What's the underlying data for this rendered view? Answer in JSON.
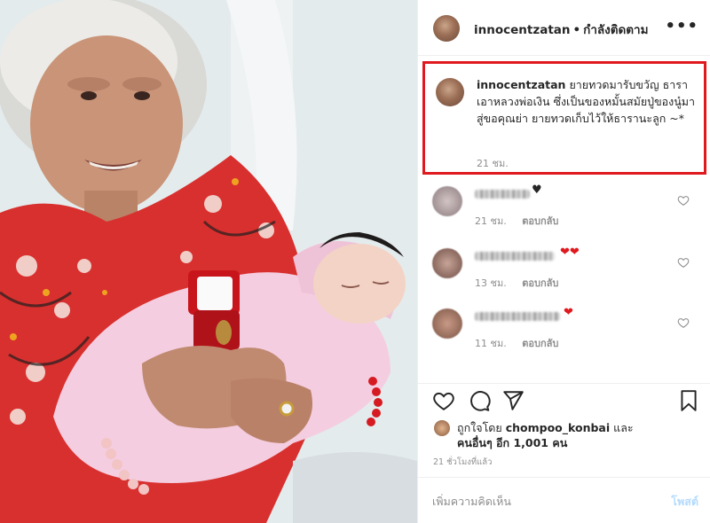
{
  "header": {
    "username": "innocentzatan",
    "separator": "•",
    "follow_status": "กำลังติดตาม",
    "more_glyph": "•••"
  },
  "caption": {
    "username": "innocentzatan",
    "text": "ยายทวดมารับขวัญ ธารา เอาหลวงพ่อเงิน ซึ่งเป็นของหมั้นสมัยปู่ของนู๋มาสู่ขอคุณย่า ยายทวดเก็บไว้ให้ธารานะลูก ~*",
    "time": "21 ชม.",
    "highlight_color": "#e0191f"
  },
  "comments": [
    {
      "time": "21 ชม.",
      "reply_label": "ตอบกลับ",
      "emoji": "♥",
      "emoji_color": "#262626"
    },
    {
      "time": "13 ชม.",
      "reply_label": "ตอบกลับ",
      "emoji": "❤❤",
      "emoji_color": "#e0191f"
    },
    {
      "time": "11 ชม.",
      "reply_label": "ตอบกลับ",
      "emoji": "❤",
      "emoji_color": "#e0191f"
    }
  ],
  "actions": {
    "like_icon": "heart-icon",
    "comment_icon": "comment-icon",
    "share_icon": "send-icon",
    "save_icon": "bookmark-icon"
  },
  "likes": {
    "prefix": "ถูกใจโดย",
    "liker": "chompoo_konbai",
    "conjunction": "และ",
    "others": "คนอื่นๆ อีก 1,001 คน"
  },
  "post_time": "21 ชั่วโมงที่แล้ว",
  "add_comment": {
    "placeholder": "เพิ่มความคิดเห็น",
    "post_label": "โพสต์"
  }
}
